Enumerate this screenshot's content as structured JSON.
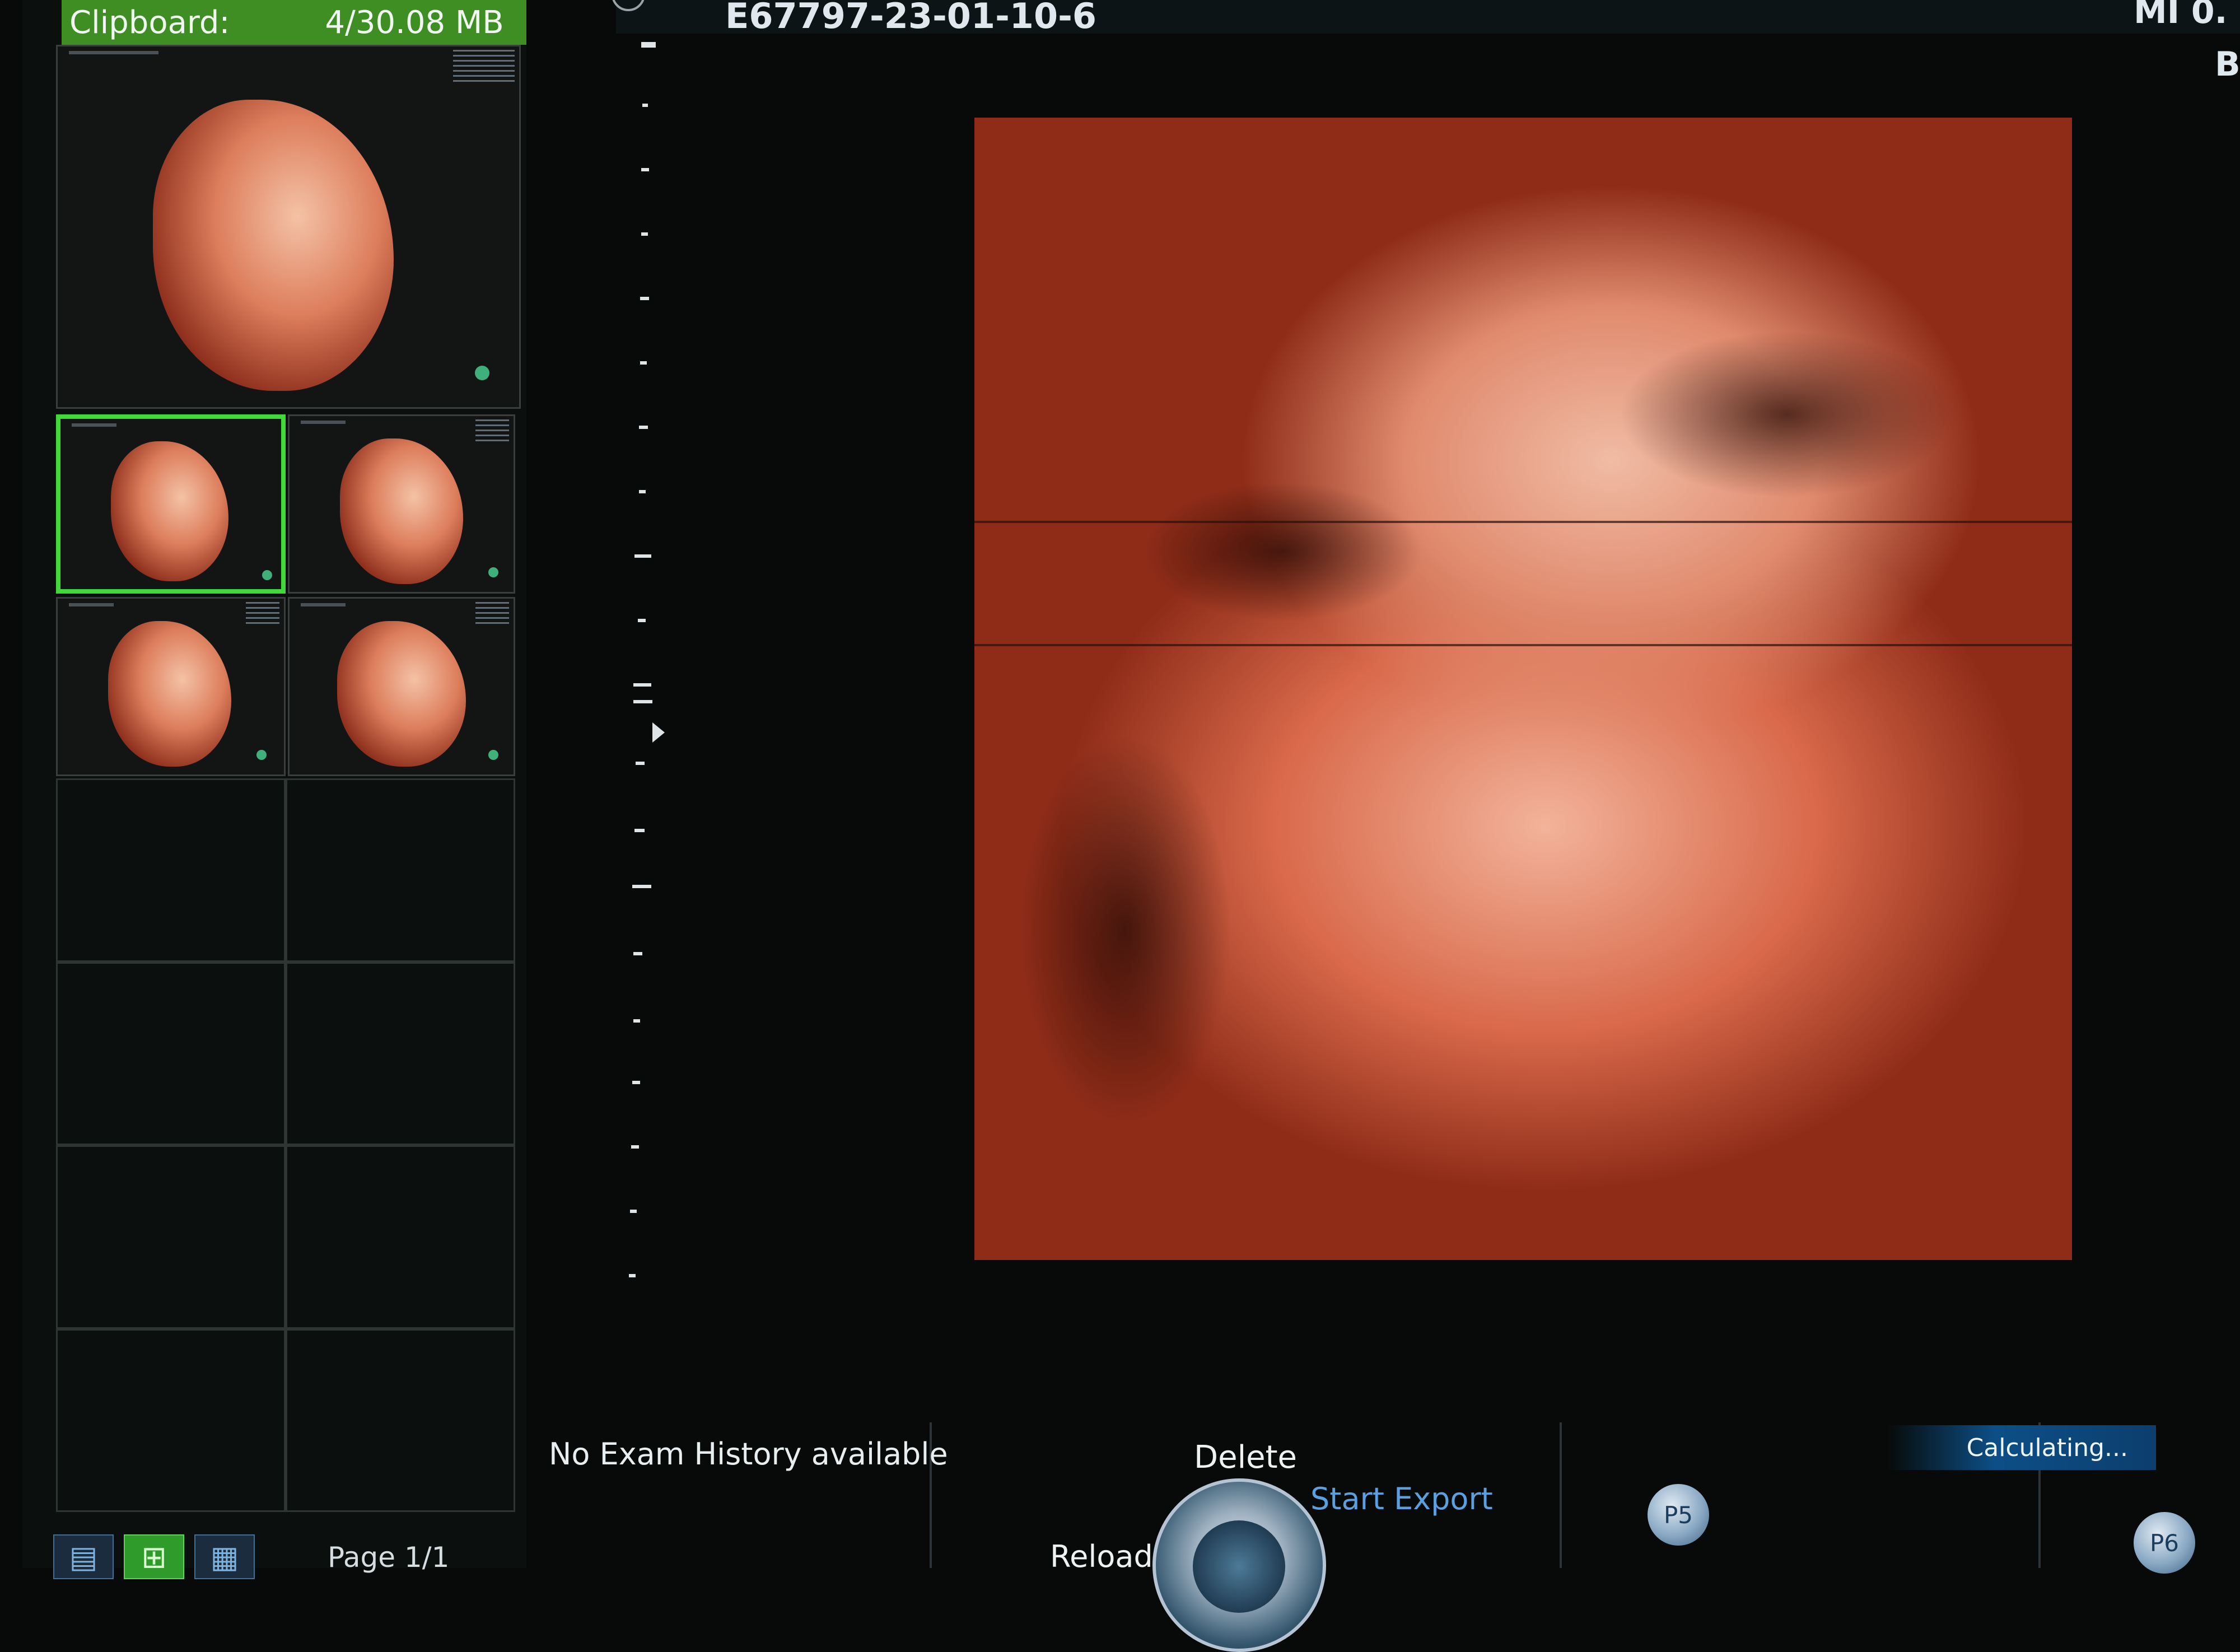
{
  "clipboard": {
    "label": "Clipboard:",
    "usage": "4/30.08 MB"
  },
  "thumbnails": [
    {
      "name": "thumbnail-1",
      "selected": false
    },
    {
      "name": "thumbnail-2",
      "selected": true
    },
    {
      "name": "thumbnail-3",
      "selected": false
    },
    {
      "name": "thumbnail-4",
      "selected": false
    },
    {
      "name": "thumbnail-5",
      "selected": false
    }
  ],
  "pagination": {
    "page_label": "Page 1/1"
  },
  "layout_buttons": [
    {
      "icon": "single-row-layout-icon",
      "active": false
    },
    {
      "icon": "2x2-grid-layout-icon",
      "active": true
    },
    {
      "icon": "3x3-grid-layout-icon",
      "active": false
    }
  ],
  "header": {
    "scan_id": "E67797-23-01-10-6",
    "mi_label": "MI 0.",
    "b_label": "B"
  },
  "exam": {
    "history_message": "No Exam History available"
  },
  "controls": {
    "delete_label": "Delete",
    "start_export_label": "Start Export",
    "reload_label": "Reload",
    "status_text": "Calculating...",
    "preset_p5": "P5",
    "preset_p6": "P6"
  },
  "colors": {
    "clipboard_bar": "#3e8e23",
    "selection_border": "#41d83a",
    "export_text": "#5aa0e0",
    "status_bar": "#0c4f86"
  }
}
